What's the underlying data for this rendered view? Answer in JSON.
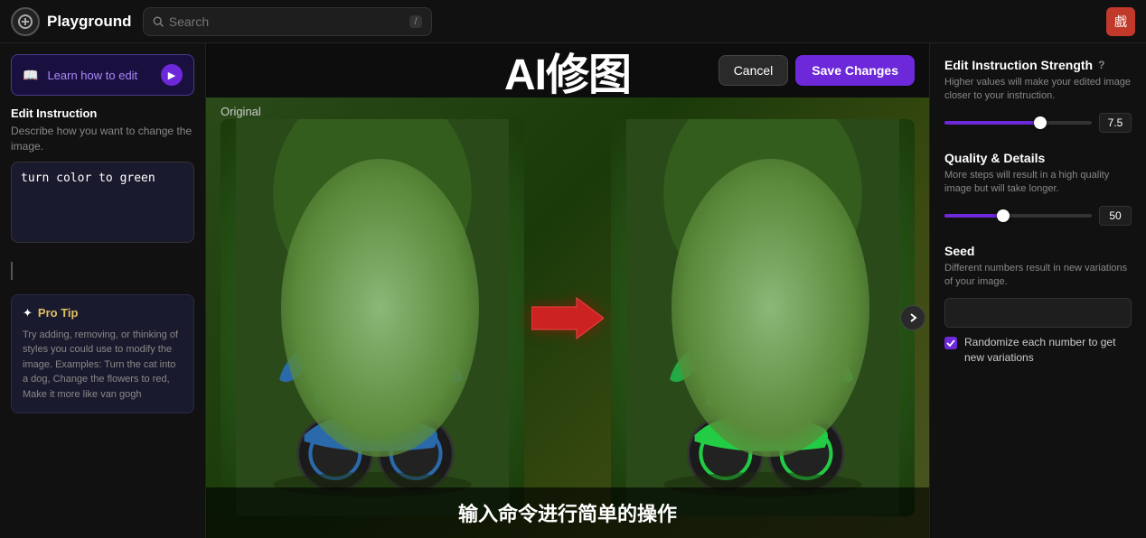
{
  "topbar": {
    "brand_name": "Playground",
    "search_placeholder": "Search",
    "kbd": "/",
    "avatar_emoji": "戲"
  },
  "left_sidebar": {
    "learn_btn_text": "Learn how to edit",
    "learn_btn_icon": "▶",
    "edit_instruction": {
      "title": "Edit Instruction",
      "description": "Describe how you want to change the image.",
      "textarea_value": "turn color to green"
    },
    "pro_tip": {
      "title": "Pro Tip",
      "icon": "✦",
      "text": "Try adding, removing, or thinking of styles you could use to modify the image. Examples: Turn the cat into a dog, Change the flowers to red, Make it more like van gogh"
    }
  },
  "center": {
    "main_title": "AI修图",
    "cancel_label": "Cancel",
    "save_label": "Save Changes",
    "image_label": "Original",
    "overlay_text": "输入命令进行简单的操作"
  },
  "right_sidebar": {
    "edit_strength": {
      "title": "Edit Instruction Strength",
      "info": "?",
      "description": "Higher values will make your edited image closer to your instruction.",
      "value": "7.5",
      "fill_pct": 65
    },
    "quality": {
      "title": "Quality & Details",
      "description": "More steps will result in a high quality image but will take longer.",
      "value": "50",
      "fill_pct": 40
    },
    "seed": {
      "title": "Seed",
      "description": "Different numbers result in new variations of your image.",
      "input_value": ""
    },
    "randomize": {
      "label": "Randomize each number to get new variations",
      "checked": true
    }
  }
}
